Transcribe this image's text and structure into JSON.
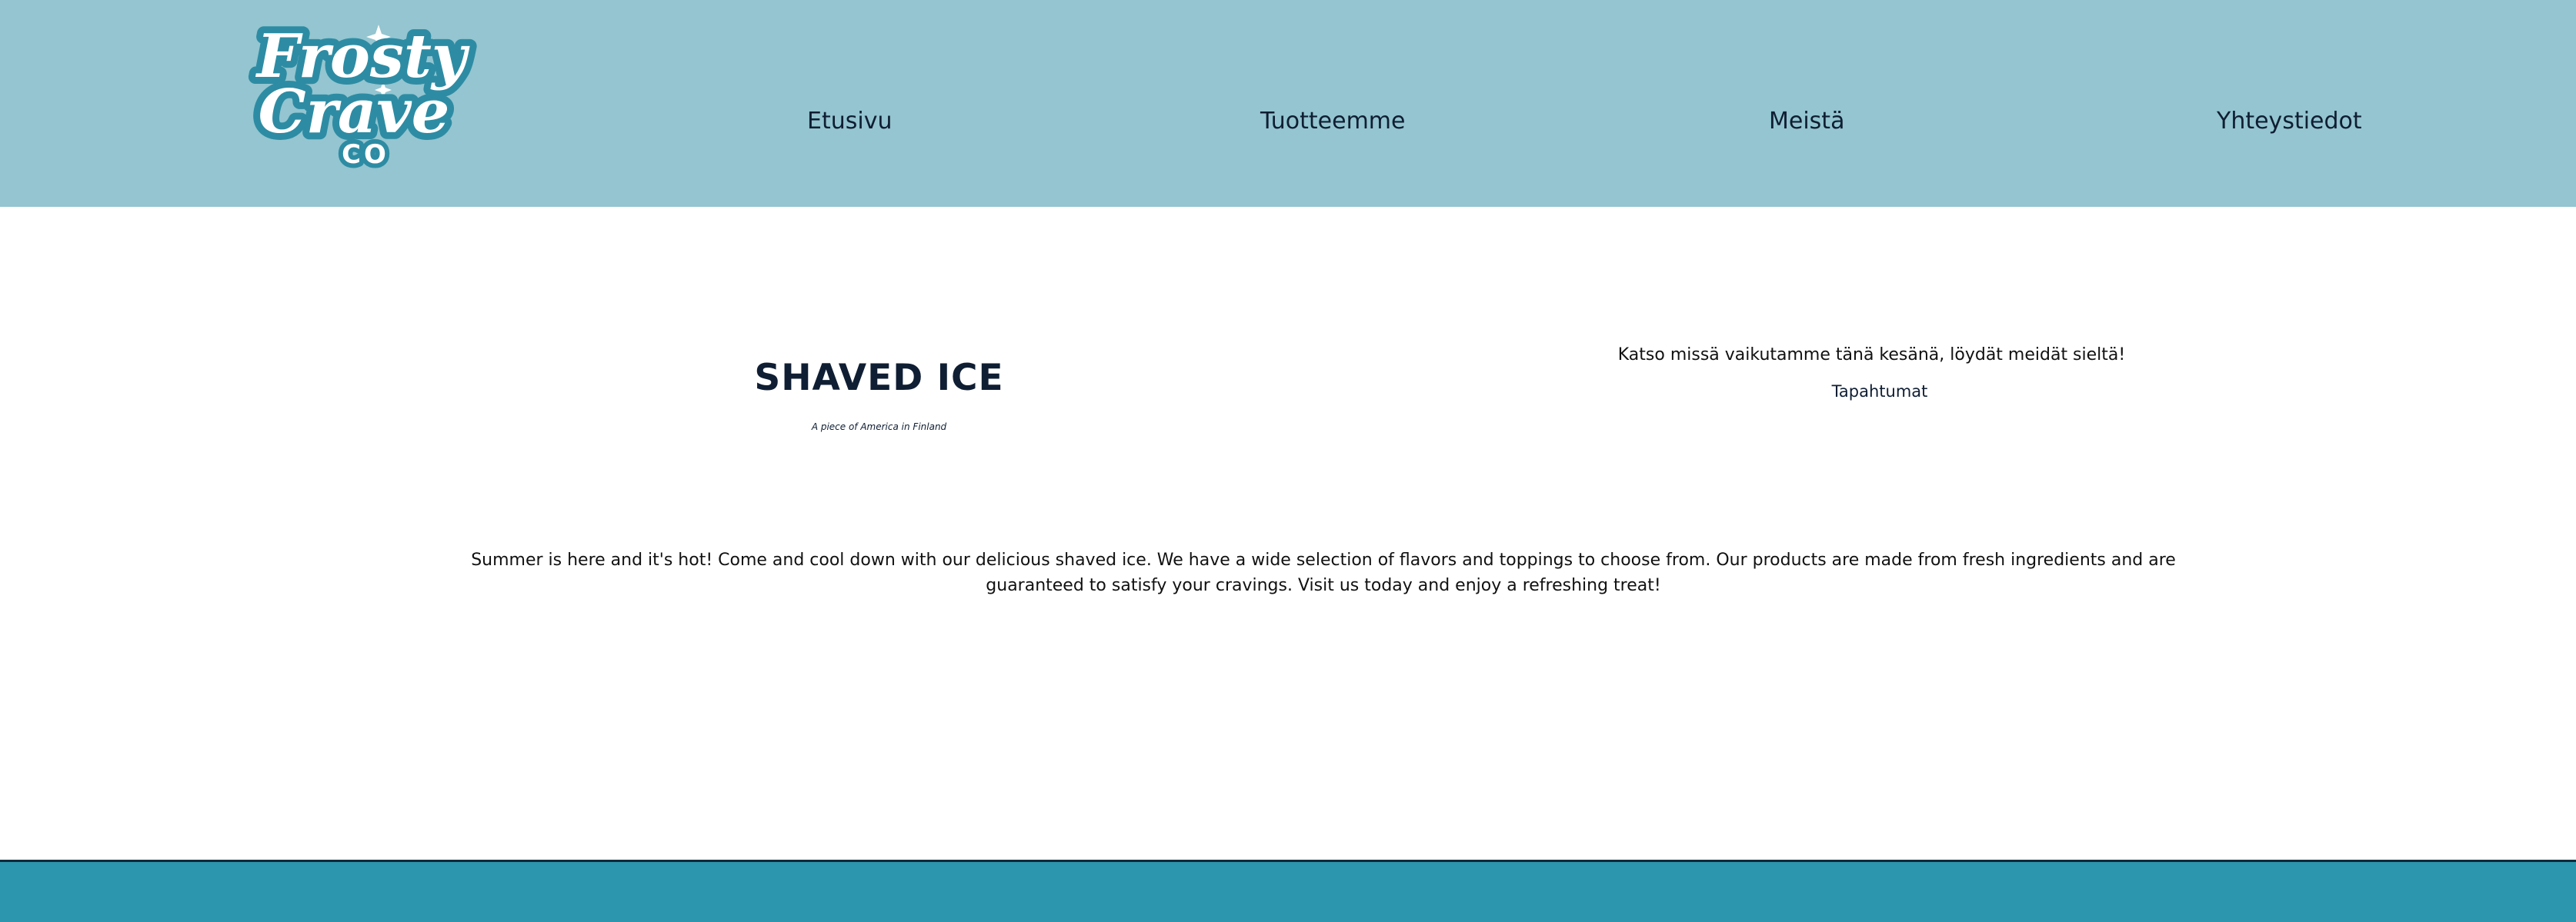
{
  "header": {
    "logo": {
      "line1": "Frosty",
      "line2": "Crave",
      "line3": "CO"
    },
    "nav": [
      {
        "label": "Etusivu"
      },
      {
        "label": "Tuotteemme"
      },
      {
        "label": "Meistä"
      },
      {
        "label": "Yhteystiedot"
      }
    ]
  },
  "hero": {
    "title": "SHAVED ICE",
    "subtitle": "A piece of America in Finland"
  },
  "events": {
    "text": "Katso missä vaikutamme tänä kesänä, löydät meidät sieltä!",
    "link_label": "Tapahtumat"
  },
  "main": {
    "description": "Summer is here and it's hot! Come and cool down with our delicious shaved ice. We have a wide selection of flavors and toppings to choose from. Our products are made from fresh ingredients and are guaranteed to satisfy your cravings. Visit us today and enjoy a refreshing treat!"
  },
  "colors": {
    "header_bg": "#94c5d0",
    "footer_bg": "#2b96ad",
    "text_dark": "#0f1e33",
    "logo_teal": "#2d8ca3"
  }
}
